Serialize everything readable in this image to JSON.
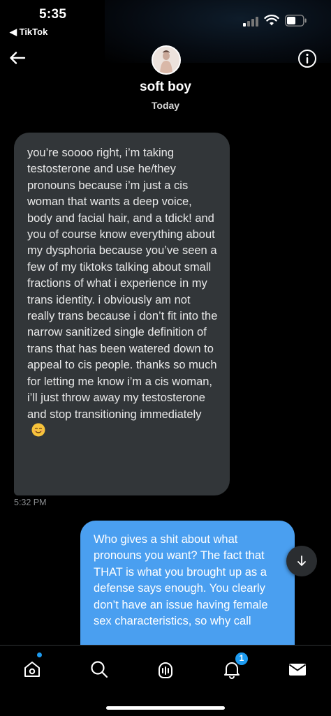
{
  "status_bar": {
    "time": "5:35",
    "back_app": "◀ TikTok",
    "icons": [
      "signal-icon",
      "wifi-icon",
      "battery-icon"
    ]
  },
  "header": {
    "contact_name": "soft boy",
    "date_label": "Today",
    "icons": [
      "back-arrow-icon",
      "info-icon"
    ]
  },
  "messages": {
    "incoming": {
      "text": "you’re soooo right, i’m taking testosterone and use he/they pronouns because i’m just a cis woman that wants a deep voice, body and facial hair, and a tdick! and you of course know everything about my dysphoria because you’ve seen a few of my tiktoks talking about small fractions of what i experience in my trans identity. i obviously am not really trans because i don’t fit into the narrow sanitized single definition of trans that has been watered down to appeal to cis people. thanks so much for letting me know i’m a cis woman, i’ll just throw away my testosterone and stop transitioning immediately",
      "emoji": "smiling-face-emoji",
      "timestamp": "5:32 PM"
    },
    "outgoing": {
      "text": "Who gives a shit about what pronouns you want? The fact that THAT is what you brought up as a defense says enough. You clearly don’t have an issue having female sex characteristics, so why call"
    }
  },
  "tabbar": {
    "tabs": [
      "home-icon",
      "search-icon",
      "spaces-icon",
      "notifications-icon",
      "messages-icon"
    ],
    "notification_count": "1"
  },
  "colors": {
    "background": "#000000",
    "incoming_bubble": "#323639",
    "outgoing_bubble": "#4a9ff0",
    "accent": "#1d9bf0"
  }
}
